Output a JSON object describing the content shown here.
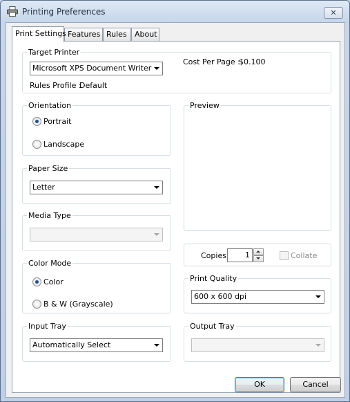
{
  "window": {
    "title": "Printing Preferences",
    "close_glyph": "✕"
  },
  "tabs": [
    {
      "label": "Print Settings",
      "active": true
    },
    {
      "label": "Features",
      "active": false
    },
    {
      "label": "Rules",
      "active": false
    },
    {
      "label": "About",
      "active": false
    }
  ],
  "target_printer": {
    "label": "Target Printer",
    "selected": "Microsoft XPS Document Writer",
    "rules_profile_label": "Rules Profile :",
    "rules_profile_value": "Default",
    "cost_label": "Cost Per Page :",
    "cost_value": "$0.100"
  },
  "orientation": {
    "label": "Orientation",
    "options": [
      "Portrait",
      "Landscape"
    ],
    "selected": "Portrait"
  },
  "preview": {
    "label": "Preview"
  },
  "paper_size": {
    "label": "Paper Size",
    "selected": "Letter"
  },
  "media_type": {
    "label": "Media Type",
    "selected": "",
    "enabled": false
  },
  "copies": {
    "label": "Copies",
    "value": "1",
    "collate_label": "Collate",
    "collate_checked": false,
    "collate_enabled": false
  },
  "color_mode": {
    "label": "Color Mode",
    "options": [
      "Color",
      "B & W (Grayscale)"
    ],
    "selected": "Color"
  },
  "print_quality": {
    "label": "Print Quality",
    "selected": "600 x 600 dpi"
  },
  "input_tray": {
    "label": "Input Tray",
    "selected": "Automatically Select"
  },
  "output_tray": {
    "label": "Output Tray",
    "selected": "",
    "enabled": false
  },
  "buttons": {
    "ok": "OK",
    "cancel": "Cancel"
  },
  "colors": {
    "accent": "#1f4f91",
    "titlebar": "#c7d6ea",
    "group_border": "#d5dfe5"
  },
  "icons": {
    "title": "printer-icon"
  }
}
